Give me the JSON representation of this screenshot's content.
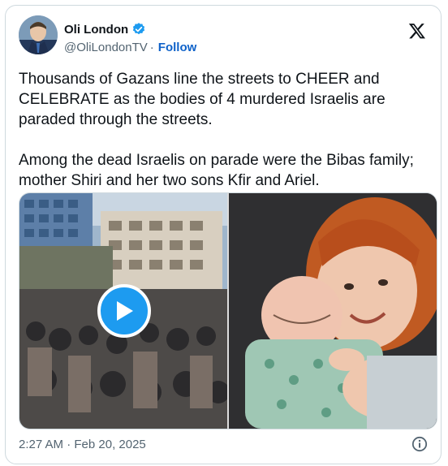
{
  "author": {
    "name": "Oli London",
    "handle": "@OliLondonTV",
    "separator": "·",
    "follow_label": "Follow",
    "verified_color": "#1d9bf0"
  },
  "tweet": {
    "paragraphs": [
      "Thousands of Gazans line the streets to CHEER and CELEBRATE as the bodies of 4 murdered Israelis are paraded through the streets.",
      "Among the dead Israelis on parade were the Bibas family; mother Shiri and her two sons Kfir and Ariel."
    ],
    "timestamp": "2:27 AM · Feb 20, 2025"
  },
  "media": {
    "left": {
      "type": "video",
      "play_icon": "play-icon"
    },
    "right": {
      "type": "photo"
    }
  },
  "icons": {
    "platform": "x-logo-icon",
    "info": "info-icon",
    "verified": "verified-badge-icon"
  }
}
